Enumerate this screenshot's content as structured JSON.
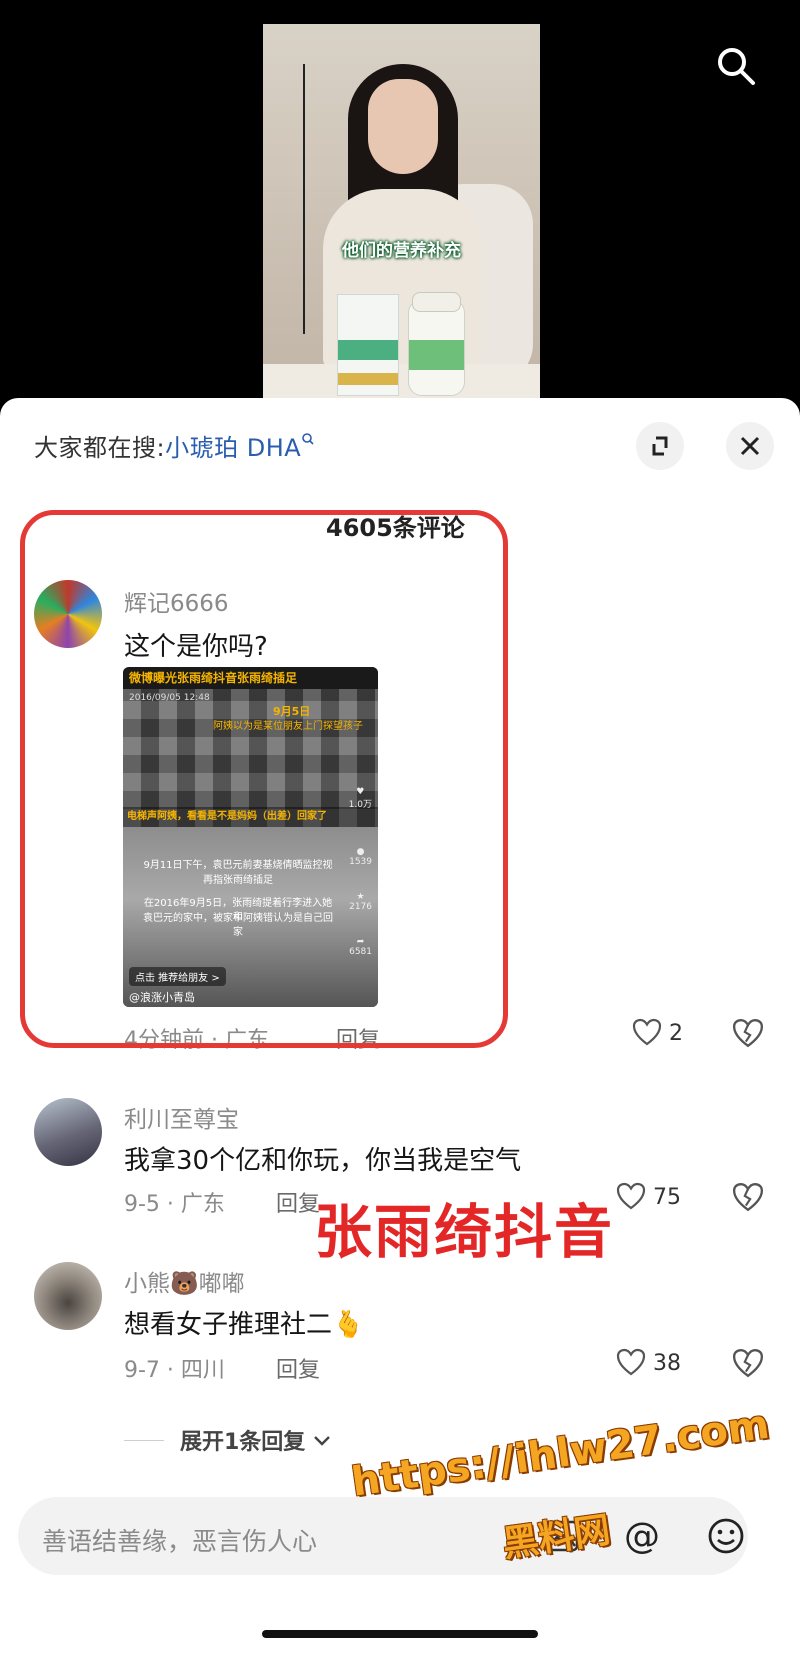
{
  "video": {
    "caption": "他们的营养补充"
  },
  "sheet": {
    "search_prefix": "大家都在搜:",
    "search_keyword": "小琥珀 DHA",
    "comment_count": "4605条评论"
  },
  "comments": [
    {
      "username": "辉记6666",
      "text": "这个是你吗?",
      "meta": "4分钟前 · 广东",
      "reply_label": "回复",
      "likes": "2",
      "embedded_image": {
        "header": "微博曝光张雨绮抖音张雨绮插足",
        "date": "2016/09/05 12:48",
        "note1": "9月5日",
        "note2": "阿姨以为是某位朋友上门探望孩子",
        "band": "电梯声阿姨，看看是不是妈妈（出差）回家了",
        "line1": "9月11日下午，袁巴元前妻基烧倩晒监控视",
        "line2": "再指张雨绮插足",
        "line3": "在2016年9月5日，张雨绮提着行李进入她和",
        "line4": "袁巴元的家中，被家中阿姨错认为是自己回家",
        "side1": "1.0万",
        "side2": "1539",
        "side3": "2176",
        "side4": "6581",
        "share": "点击 推荐给朋友 >",
        "handle": "@浪涨小青岛"
      }
    },
    {
      "username": "利川至尊宝",
      "text": "我拿30个亿和你玩，你当我是空气",
      "meta": "9-5 · 广东",
      "reply_label": "回复",
      "likes": "75"
    },
    {
      "username": "小熊🐻嘟嘟",
      "text": "想看女子推理社二🫰",
      "meta": "9-7 · 四川",
      "reply_label": "回复",
      "likes": "38"
    }
  ],
  "expand_replies": "展开1条回复",
  "input": {
    "placeholder": "善语结善缘，恶言伤人心"
  },
  "overlay": {
    "title": "张雨绮抖音",
    "watermark_url": "https://ihlw27.com",
    "watermark_site": "黑料网"
  },
  "colors": {
    "accent_red": "#e53935",
    "link_blue": "#2a5db0",
    "watermark": "#f4a623"
  }
}
